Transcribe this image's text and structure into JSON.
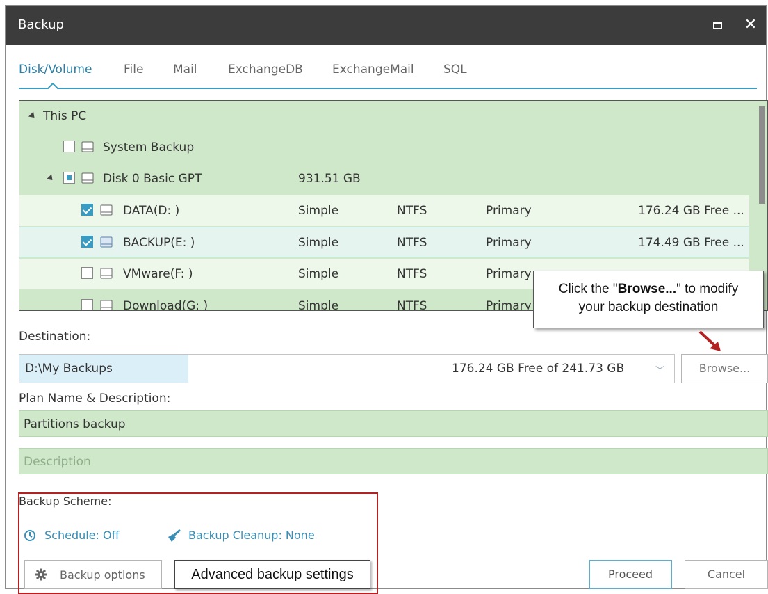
{
  "window": {
    "title": "Backup"
  },
  "tabs": [
    {
      "label": "Disk/Volume",
      "active": true
    },
    {
      "label": "File"
    },
    {
      "label": "Mail"
    },
    {
      "label": "ExchangeDB"
    },
    {
      "label": "ExchangeMail"
    },
    {
      "label": "SQL"
    }
  ],
  "tree": {
    "root": "This PC",
    "system_backup": "System Backup",
    "disk": {
      "name": "Disk 0 Basic GPT",
      "size": "931.51 GB"
    },
    "volumes": [
      {
        "name": "DATA(D: )",
        "type": "Simple",
        "fs": "NTFS",
        "role": "Primary",
        "free": "176.24 GB Free ...",
        "checked": true
      },
      {
        "name": "BACKUP(E: )",
        "type": "Simple",
        "fs": "NTFS",
        "role": "Primary",
        "free": "174.49 GB Free ...",
        "checked": true
      },
      {
        "name": "VMware(F: )",
        "type": "Simple",
        "fs": "NTFS",
        "role": "Primary",
        "free": "",
        "checked": false
      },
      {
        "name": "Download(G: )",
        "type": "Simple",
        "fs": "NTFS",
        "role": "Primary",
        "free": "",
        "checked": false
      }
    ]
  },
  "destination": {
    "label": "Destination:",
    "path": "D:\\My Backups",
    "free": "176.24 GB Free of 241.73 GB",
    "browse_label": "Browse..."
  },
  "plan": {
    "label": "Plan Name & Description:",
    "name": "Partitions backup",
    "description_placeholder": "Description"
  },
  "scheme": {
    "label": "Backup Scheme:",
    "schedule": "Schedule: Off",
    "cleanup": "Backup Cleanup: None",
    "options_label": "Backup options"
  },
  "actions": {
    "proceed": "Proceed",
    "cancel": "Cancel"
  },
  "annotations": {
    "browse_prefix": "Click the \"",
    "browse_bold": "Browse...",
    "browse_suffix": "\" to modify",
    "browse_line2": "your backup destination",
    "advanced": "Advanced backup settings"
  },
  "colors": {
    "accent": "#3a9bc2",
    "tree_bg": "#cfe8c9",
    "highlight": "#b22222",
    "titlebar": "#3c3c3c"
  }
}
